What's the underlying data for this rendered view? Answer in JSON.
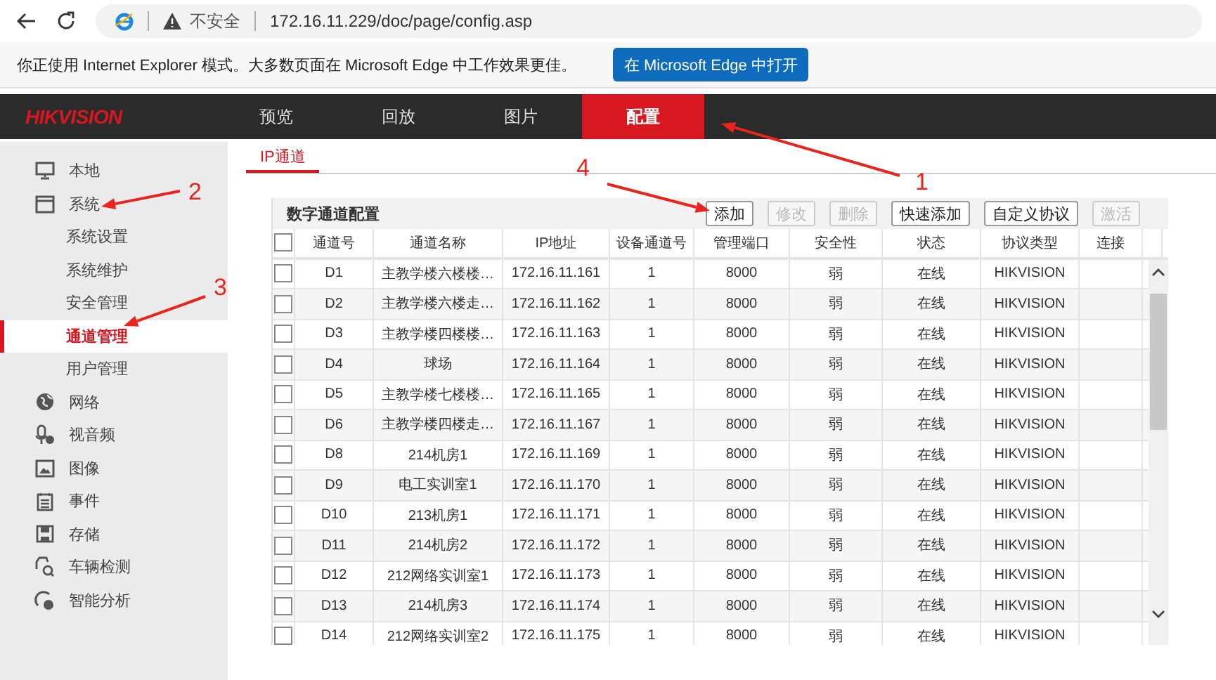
{
  "browser": {
    "security": "不安全",
    "url": "172.16.11.229/doc/page/config.asp"
  },
  "ie_banner": {
    "message": "你正使用 Internet Explorer 模式。大多数页面在 Microsoft Edge 中工作效果更佳。",
    "button": "在 Microsoft Edge 中打开"
  },
  "nav": {
    "logo": "HIKVISION",
    "tabs": [
      {
        "label": "预览",
        "selected": false
      },
      {
        "label": "回放",
        "selected": false
      },
      {
        "label": "图片",
        "selected": false
      },
      {
        "label": "配置",
        "selected": true
      }
    ]
  },
  "sidebar": {
    "items": [
      {
        "kind": "group",
        "label": "本地",
        "selected": false
      },
      {
        "kind": "group",
        "label": "系统",
        "selected": false
      },
      {
        "kind": "sub",
        "label": "系统设置",
        "selected": false
      },
      {
        "kind": "sub",
        "label": "系统维护",
        "selected": false
      },
      {
        "kind": "sub",
        "label": "安全管理",
        "selected": false
      },
      {
        "kind": "sub",
        "label": "通道管理",
        "selected": true
      },
      {
        "kind": "sub",
        "label": "用户管理",
        "selected": false
      },
      {
        "kind": "group",
        "label": "网络",
        "selected": false
      },
      {
        "kind": "group",
        "label": "视音频",
        "selected": false
      },
      {
        "kind": "group",
        "label": "图像",
        "selected": false
      },
      {
        "kind": "group",
        "label": "事件",
        "selected": false
      },
      {
        "kind": "group",
        "label": "存储",
        "selected": false
      },
      {
        "kind": "group",
        "label": "车辆检测",
        "selected": false
      },
      {
        "kind": "group",
        "label": "智能分析",
        "selected": false
      }
    ]
  },
  "tabs": [
    {
      "label": "IP通道",
      "selected": true
    }
  ],
  "panel": {
    "title": "数字通道配置",
    "buttons": [
      {
        "label": "添加",
        "disabled": false
      },
      {
        "label": "修改",
        "disabled": true
      },
      {
        "label": "删除",
        "disabled": true
      },
      {
        "label": "快速添加",
        "disabled": false
      },
      {
        "label": "自定义协议",
        "disabled": false
      },
      {
        "label": "激活",
        "disabled": true
      }
    ]
  },
  "table": {
    "header_checked": false,
    "columns": [
      "通道号",
      "通道名称",
      "IP地址",
      "设备通道号",
      "管理端口",
      "安全性",
      "状态",
      "协议类型",
      "连接"
    ],
    "rows": [
      {
        "checked": false,
        "cells": [
          "D1",
          "主教学楼六楼楼…",
          "172.16.11.161",
          "1",
          "8000",
          "弱",
          "在线",
          "HIKVISION"
        ]
      },
      {
        "checked": false,
        "cells": [
          "D2",
          "主教学楼六楼走…",
          "172.16.11.162",
          "1",
          "8000",
          "弱",
          "在线",
          "HIKVISION"
        ]
      },
      {
        "checked": false,
        "cells": [
          "D3",
          "主教学楼四楼楼…",
          "172.16.11.163",
          "1",
          "8000",
          "弱",
          "在线",
          "HIKVISION"
        ]
      },
      {
        "checked": false,
        "cells": [
          "D4",
          "球场",
          "172.16.11.164",
          "1",
          "8000",
          "弱",
          "在线",
          "HIKVISION"
        ]
      },
      {
        "checked": false,
        "cells": [
          "D5",
          "主教学楼七楼楼…",
          "172.16.11.165",
          "1",
          "8000",
          "弱",
          "在线",
          "HIKVISION"
        ]
      },
      {
        "checked": false,
        "cells": [
          "D6",
          "主教学楼四楼走…",
          "172.16.11.167",
          "1",
          "8000",
          "弱",
          "在线",
          "HIKVISION"
        ]
      },
      {
        "checked": false,
        "cells": [
          "D8",
          "214机房1",
          "172.16.11.169",
          "1",
          "8000",
          "弱",
          "在线",
          "HIKVISION"
        ]
      },
      {
        "checked": false,
        "cells": [
          "D9",
          "电工实训室1",
          "172.16.11.170",
          "1",
          "8000",
          "弱",
          "在线",
          "HIKVISION"
        ]
      },
      {
        "checked": false,
        "cells": [
          "D10",
          "213机房1",
          "172.16.11.171",
          "1",
          "8000",
          "弱",
          "在线",
          "HIKVISION"
        ]
      },
      {
        "checked": false,
        "cells": [
          "D11",
          "214机房2",
          "172.16.11.172",
          "1",
          "8000",
          "弱",
          "在线",
          "HIKVISION"
        ]
      },
      {
        "checked": false,
        "cells": [
          "D12",
          "212网络实训室1",
          "172.16.11.173",
          "1",
          "8000",
          "弱",
          "在线",
          "HIKVISION"
        ]
      },
      {
        "checked": false,
        "cells": [
          "D13",
          "214机房3",
          "172.16.11.174",
          "1",
          "8000",
          "弱",
          "在线",
          "HIKVISION"
        ]
      },
      {
        "checked": false,
        "cells": [
          "D14",
          "212网络实训室2",
          "172.16.11.175",
          "1",
          "8000",
          "弱",
          "在线",
          "HIKVISION"
        ]
      }
    ]
  },
  "annotations": [
    {
      "label": "1"
    },
    {
      "label": "2"
    },
    {
      "label": "3"
    },
    {
      "label": "4"
    }
  ]
}
